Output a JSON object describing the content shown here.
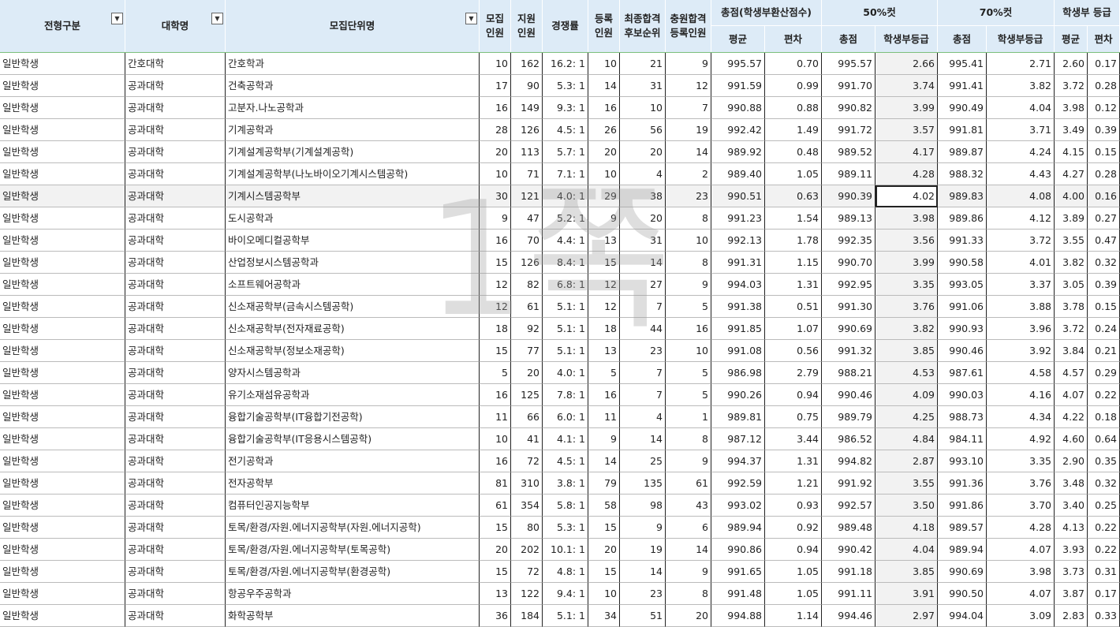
{
  "headers": {
    "col_type": "전형구분",
    "col_univ": "대학명",
    "col_unit": "모집단위명",
    "col_quota_1": "모집",
    "col_quota_2": "인원",
    "col_apply_1": "지원",
    "col_apply_2": "인원",
    "col_ratio": "경쟁률",
    "col_reg_1": "등록",
    "col_reg_2": "인원",
    "col_final_1": "최종합격",
    "col_final_2": "후보순위",
    "col_extra_1": "충원합격",
    "col_extra_2": "등록인원",
    "grp_total": "총점(학생부환산점수)",
    "grp_50": "50%컷",
    "grp_70": "70%컷",
    "grp_grade": "학생부 등급",
    "sub_avg": "평균",
    "sub_dev": "편차",
    "sub_total_50": "총점",
    "sub_grade_50": "학생부등급",
    "sub_total_70": "총점",
    "sub_grade_70": "학생부등급",
    "sub_gavg": "평균",
    "sub_gdev": "편차"
  },
  "filter_icon": "dropdown-arrow-icon",
  "watermark": "1쪽",
  "rows": [
    [
      "일반학생",
      "간호대학",
      "간호학과",
      "10",
      "162",
      "16.2: 1",
      "10",
      "21",
      "9",
      "995.57",
      "0.70",
      "995.57",
      "2.66",
      "995.41",
      "2.71",
      "2.60",
      "0.17"
    ],
    [
      "일반학생",
      "공과대학",
      "건축공학과",
      "17",
      "90",
      "5.3: 1",
      "14",
      "31",
      "12",
      "991.59",
      "0.99",
      "991.70",
      "3.74",
      "991.41",
      "3.82",
      "3.72",
      "0.28"
    ],
    [
      "일반학생",
      "공과대학",
      "고분자.나노공학과",
      "16",
      "149",
      "9.3: 1",
      "16",
      "10",
      "7",
      "990.88",
      "0.88",
      "990.82",
      "3.99",
      "990.49",
      "4.04",
      "3.98",
      "0.12"
    ],
    [
      "일반학생",
      "공과대학",
      "기계공학과",
      "28",
      "126",
      "4.5: 1",
      "26",
      "56",
      "19",
      "992.42",
      "1.49",
      "991.72",
      "3.57",
      "991.81",
      "3.71",
      "3.49",
      "0.39"
    ],
    [
      "일반학생",
      "공과대학",
      "기계설계공학부(기계설계공학)",
      "20",
      "113",
      "5.7: 1",
      "20",
      "20",
      "14",
      "989.92",
      "0.48",
      "989.52",
      "4.17",
      "989.87",
      "4.24",
      "4.15",
      "0.15"
    ],
    [
      "일반학생",
      "공과대학",
      "기계설계공학부(나노바이오기계시스템공학)",
      "10",
      "71",
      "7.1: 1",
      "10",
      "4",
      "2",
      "989.40",
      "1.05",
      "989.11",
      "4.28",
      "988.32",
      "4.43",
      "4.27",
      "0.28"
    ],
    [
      "일반학생",
      "공과대학",
      "기계시스템공학부",
      "30",
      "121",
      "4.0: 1",
      "29",
      "38",
      "23",
      "990.51",
      "0.63",
      "990.39",
      "4.02",
      "989.83",
      "4.08",
      "4.00",
      "0.16"
    ],
    [
      "일반학생",
      "공과대학",
      "도시공학과",
      "9",
      "47",
      "5.2: 1",
      "9",
      "20",
      "8",
      "991.23",
      "1.54",
      "989.13",
      "3.98",
      "989.86",
      "4.12",
      "3.89",
      "0.27"
    ],
    [
      "일반학생",
      "공과대학",
      "바이오메디컬공학부",
      "16",
      "70",
      "4.4: 1",
      "13",
      "31",
      "10",
      "992.13",
      "1.78",
      "992.35",
      "3.56",
      "991.33",
      "3.72",
      "3.55",
      "0.47"
    ],
    [
      "일반학생",
      "공과대학",
      "산업정보시스템공학과",
      "15",
      "126",
      "8.4: 1",
      "15",
      "14",
      "8",
      "991.31",
      "1.15",
      "990.70",
      "3.99",
      "990.58",
      "4.01",
      "3.82",
      "0.32"
    ],
    [
      "일반학생",
      "공과대학",
      "소프트웨어공학과",
      "12",
      "82",
      "6.8: 1",
      "12",
      "27",
      "9",
      "994.03",
      "1.31",
      "992.95",
      "3.35",
      "993.05",
      "3.37",
      "3.05",
      "0.39"
    ],
    [
      "일반학생",
      "공과대학",
      "신소재공학부(금속시스템공학)",
      "12",
      "61",
      "5.1: 1",
      "12",
      "7",
      "5",
      "991.38",
      "0.51",
      "991.30",
      "3.76",
      "991.06",
      "3.88",
      "3.78",
      "0.15"
    ],
    [
      "일반학생",
      "공과대학",
      "신소재공학부(전자재료공학)",
      "18",
      "92",
      "5.1: 1",
      "18",
      "44",
      "16",
      "991.85",
      "1.07",
      "990.69",
      "3.82",
      "990.93",
      "3.96",
      "3.72",
      "0.24"
    ],
    [
      "일반학생",
      "공과대학",
      "신소재공학부(정보소재공학)",
      "15",
      "77",
      "5.1: 1",
      "13",
      "23",
      "10",
      "991.08",
      "0.56",
      "991.32",
      "3.85",
      "990.46",
      "3.92",
      "3.84",
      "0.21"
    ],
    [
      "일반학생",
      "공과대학",
      "양자시스템공학과",
      "5",
      "20",
      "4.0: 1",
      "5",
      "7",
      "5",
      "986.98",
      "2.79",
      "988.21",
      "4.53",
      "987.61",
      "4.58",
      "4.57",
      "0.29"
    ],
    [
      "일반학생",
      "공과대학",
      "유기소재섬유공학과",
      "16",
      "125",
      "7.8: 1",
      "16",
      "7",
      "5",
      "990.26",
      "0.94",
      "990.46",
      "4.09",
      "990.03",
      "4.16",
      "4.07",
      "0.22"
    ],
    [
      "일반학생",
      "공과대학",
      "융합기술공학부(IT융합기전공학)",
      "11",
      "66",
      "6.0: 1",
      "11",
      "4",
      "1",
      "989.81",
      "0.75",
      "989.79",
      "4.25",
      "988.73",
      "4.34",
      "4.22",
      "0.18"
    ],
    [
      "일반학생",
      "공과대학",
      "융합기술공학부(IT응용시스템공학)",
      "10",
      "41",
      "4.1: 1",
      "9",
      "14",
      "8",
      "987.12",
      "3.44",
      "986.52",
      "4.84",
      "984.11",
      "4.92",
      "4.60",
      "0.64"
    ],
    [
      "일반학생",
      "공과대학",
      "전기공학과",
      "16",
      "72",
      "4.5: 1",
      "14",
      "25",
      "9",
      "994.37",
      "1.31",
      "994.82",
      "2.87",
      "993.10",
      "3.35",
      "2.90",
      "0.35"
    ],
    [
      "일반학생",
      "공과대학",
      "전자공학부",
      "81",
      "310",
      "3.8: 1",
      "79",
      "135",
      "61",
      "992.59",
      "1.21",
      "991.92",
      "3.55",
      "991.36",
      "3.76",
      "3.48",
      "0.32"
    ],
    [
      "일반학생",
      "공과대학",
      "컴퓨터인공지능학부",
      "61",
      "354",
      "5.8: 1",
      "58",
      "98",
      "43",
      "993.02",
      "0.93",
      "992.57",
      "3.50",
      "991.86",
      "3.70",
      "3.40",
      "0.25"
    ],
    [
      "일반학생",
      "공과대학",
      "토목/환경/자원.에너지공학부(자원.에너지공학)",
      "15",
      "80",
      "5.3: 1",
      "15",
      "9",
      "6",
      "989.94",
      "0.92",
      "989.48",
      "4.18",
      "989.57",
      "4.28",
      "4.13",
      "0.22"
    ],
    [
      "일반학생",
      "공과대학",
      "토목/환경/자원.에너지공학부(토목공학)",
      "20",
      "202",
      "10.1: 1",
      "20",
      "19",
      "14",
      "990.86",
      "0.94",
      "990.42",
      "4.04",
      "989.94",
      "4.07",
      "3.93",
      "0.22"
    ],
    [
      "일반학생",
      "공과대학",
      "토목/환경/자원.에너지공학부(환경공학)",
      "15",
      "72",
      "4.8: 1",
      "15",
      "14",
      "9",
      "991.65",
      "1.05",
      "991.18",
      "3.85",
      "990.69",
      "3.98",
      "3.73",
      "0.31"
    ],
    [
      "일반학생",
      "공과대학",
      "항공우주공학과",
      "13",
      "122",
      "9.4: 1",
      "10",
      "23",
      "8",
      "991.48",
      "1.05",
      "991.11",
      "3.91",
      "990.50",
      "4.07",
      "3.87",
      "0.17"
    ],
    [
      "일반학생",
      "공과대학",
      "화학공학부",
      "36",
      "184",
      "5.1: 1",
      "34",
      "51",
      "20",
      "994.88",
      "1.14",
      "994.46",
      "2.97",
      "994.04",
      "3.09",
      "2.83",
      "0.33"
    ]
  ]
}
